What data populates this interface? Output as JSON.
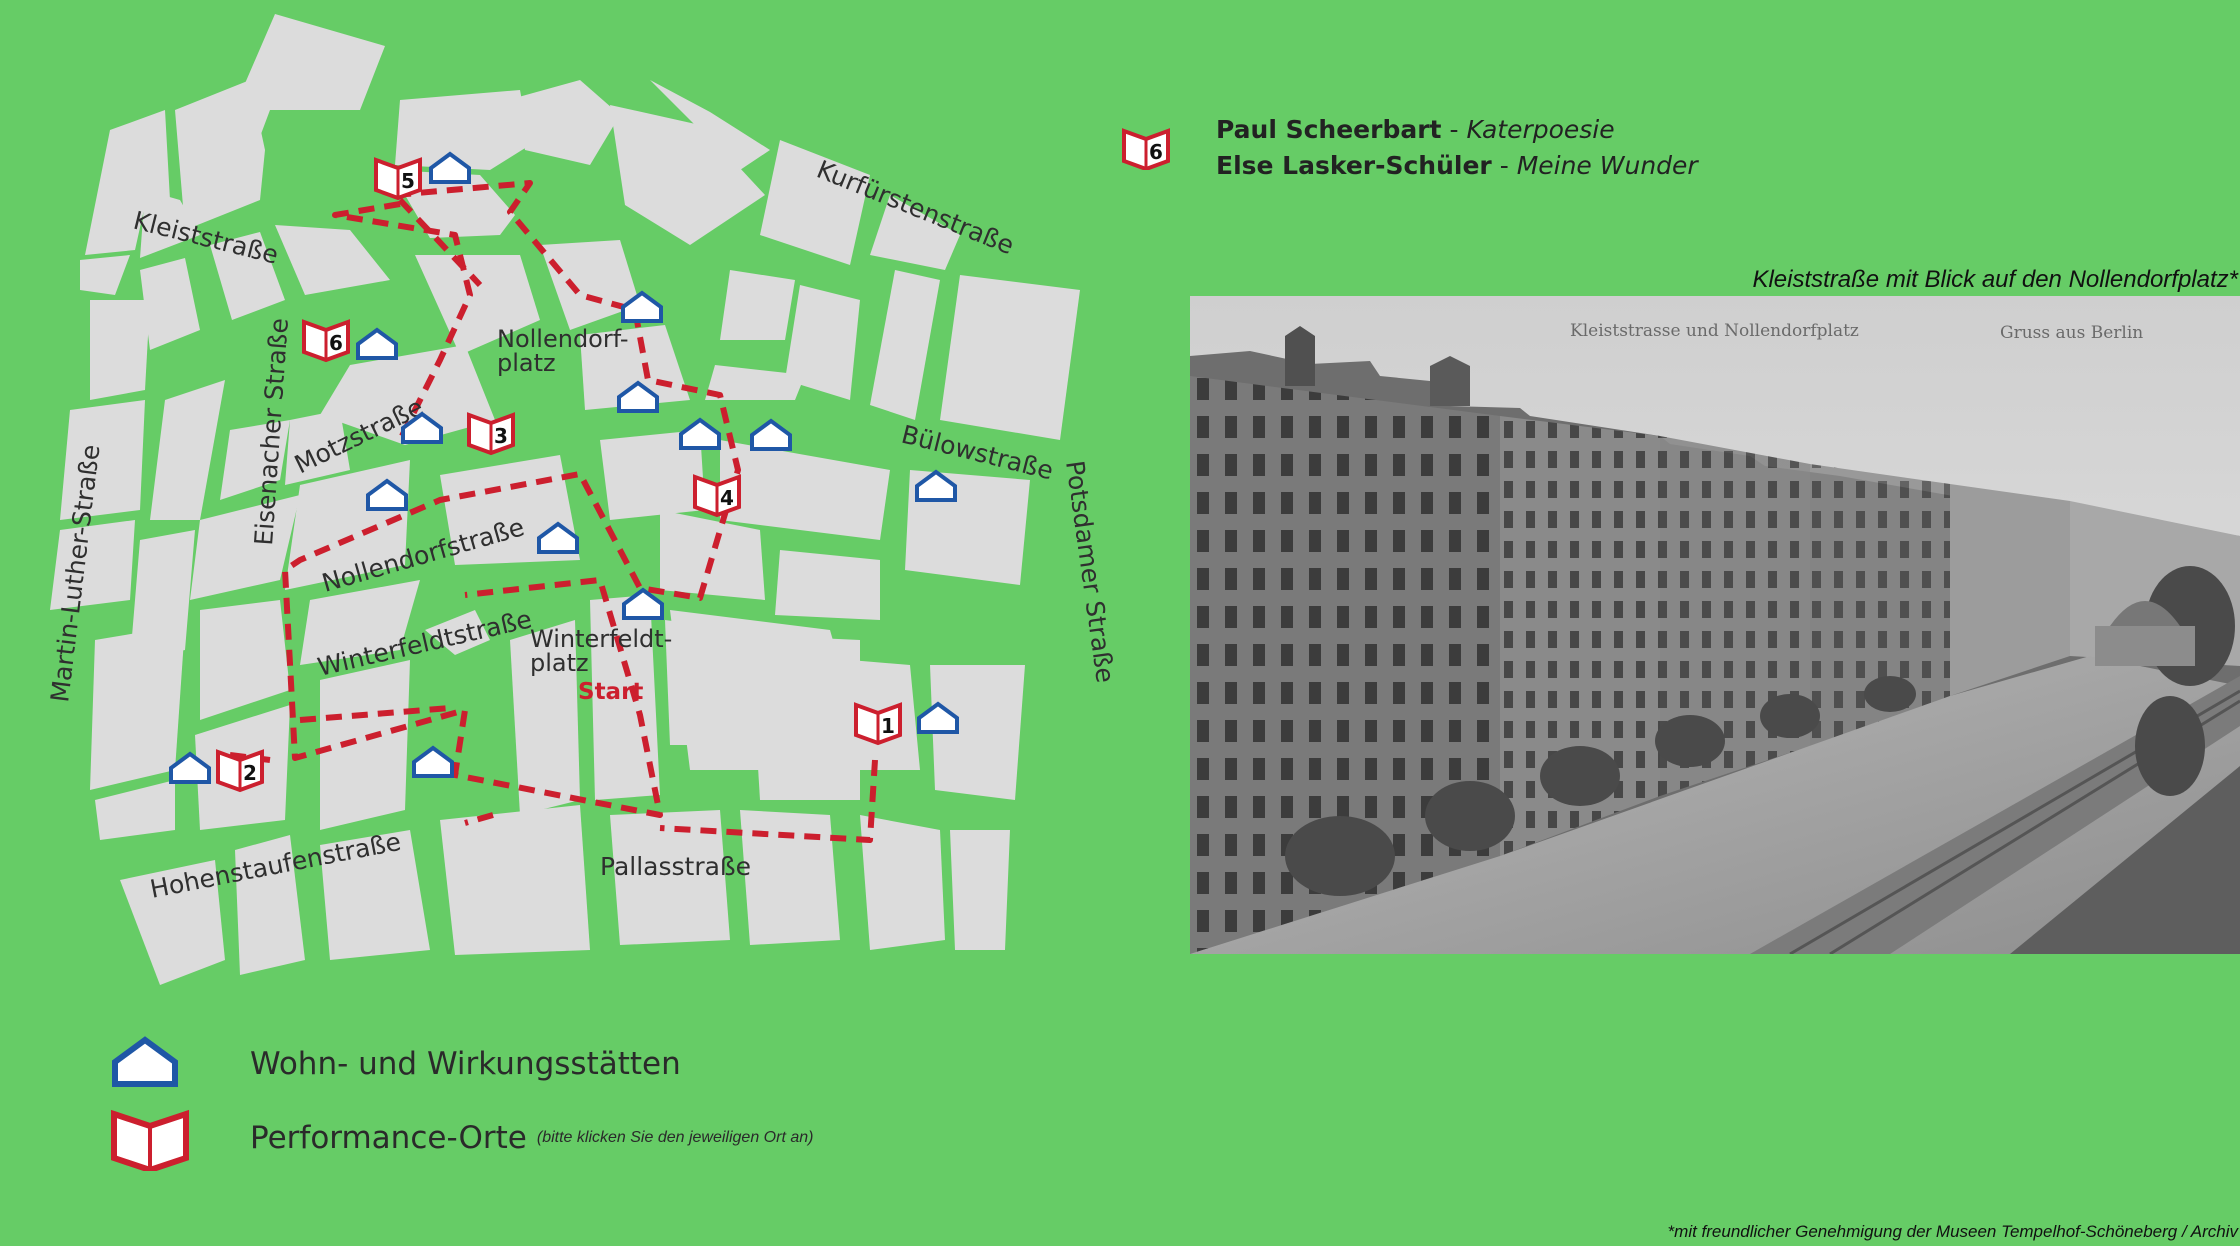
{
  "map": {
    "streets": {
      "kleiststrasse": "Kleiststraße",
      "kurfuerstenstrasse": "Kurfürstenstraße",
      "eisenacher": "Eisenacher Straße",
      "motzstrasse": "Motzstraße",
      "martin_luther": "Martin-Luther-Straße",
      "nollendorfstrasse": "Nollendorfstraße",
      "winterfeldtstrasse": "Winterfeldtstraße",
      "hohenstaufenstrasse": "Hohenstaufenstraße",
      "pallasstrasse": "Pallasstraße",
      "buelowstrasse": "Bülowstraße",
      "potsdamer": "Potsdamer Straße"
    },
    "places": {
      "nollendorfplatz_line1": "Nollendorf-",
      "nollendorfplatz_line2": "platz",
      "winterfeldtplatz_line1": "Winterfeldt-",
      "winterfeldtplatz_line2": "platz"
    },
    "start_label": "Start",
    "performance_places": [
      "1",
      "2",
      "3",
      "4",
      "5",
      "6"
    ]
  },
  "info": {
    "marker_number": "6",
    "line1_name": "Paul Scheerbart",
    "line1_separator": " - ",
    "line1_work": "Katerpoesie",
    "line2_name": "Else Lasker-Schüler",
    "line2_separator": " - ",
    "line2_work": "Meine Wunder"
  },
  "photo": {
    "caption": "Kleiststraße mit Blick auf den Nollendorfplatz*",
    "inscription_left": "Kleiststrasse und Nollendorfplatz",
    "inscription_right": "Gruss aus Berlin"
  },
  "legend": {
    "house_label": "Wohn- und Wirkungsstätten",
    "book_label": "Performance-Orte",
    "book_hint": "(bitte klicken Sie den jeweiligen Ort an)"
  },
  "footer": "*mit freundlicher Genehmigung der Museen Tempelhof-Schöneberg / Archiv",
  "colors": {
    "background": "#66cc66",
    "blocks": "#dcdcdc",
    "route": "#cc1f2e",
    "house_icon": "#1f57a6",
    "book_icon": "#cc1f2e"
  }
}
